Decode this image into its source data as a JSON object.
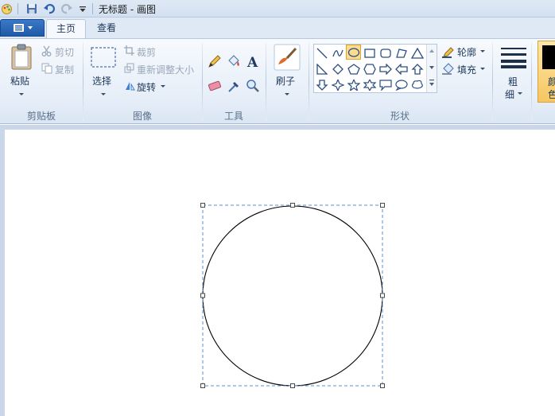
{
  "window": {
    "title": "无标题 - 画图"
  },
  "tabs": [
    {
      "label": "主页",
      "active": true
    },
    {
      "label": "查看",
      "active": false
    }
  ],
  "clipboard": {
    "paste": "粘贴",
    "cut": "剪切",
    "copy": "复制",
    "group": "剪贴板"
  },
  "image": {
    "select": "选择",
    "crop": "裁剪",
    "resize": "重新调整大小",
    "rotate": "旋转",
    "group": "图像"
  },
  "tools": {
    "group": "工具"
  },
  "brush": {
    "label": "刷子"
  },
  "shapes": {
    "outline": "轮廓",
    "fill": "填充",
    "group": "形状"
  },
  "size": {
    "label_line1": "粗",
    "label_line2": "细"
  },
  "color": {
    "label_line1": "颜",
    "label_line2": "色"
  },
  "colors": {
    "accent": "#1f5aa8",
    "selected_shape": "#fbdc8f",
    "selection_border": "#5b8fc9"
  }
}
